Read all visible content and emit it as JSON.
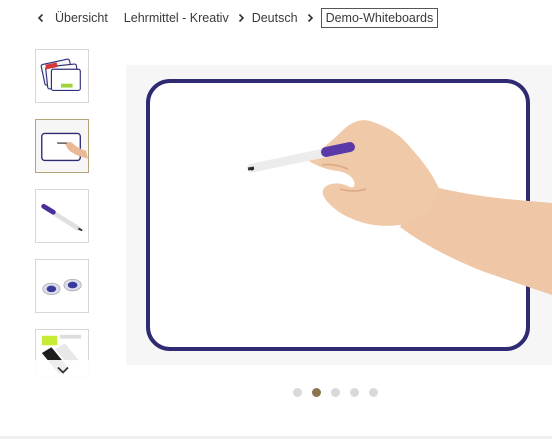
{
  "breadcrumb": {
    "back_label": "Übersicht",
    "items": [
      "Lehrmittel - Kreativ",
      "Deutsch"
    ],
    "current": "Demo-Whiteboards"
  },
  "gallery": {
    "thumbnail_count": 5,
    "active_thumbnail": 2,
    "dot_count": 5,
    "active_dot": 2
  },
  "icons": {
    "back": "chevron-left-icon",
    "separator": "chevron-right-icon",
    "scroll_down": "chevron-down-icon"
  },
  "colors": {
    "board_frame": "#2f2b73",
    "marker_cap": "#5a3aa8",
    "active_dot": "#8a7550",
    "inactive_dot": "#d9d9d9"
  }
}
